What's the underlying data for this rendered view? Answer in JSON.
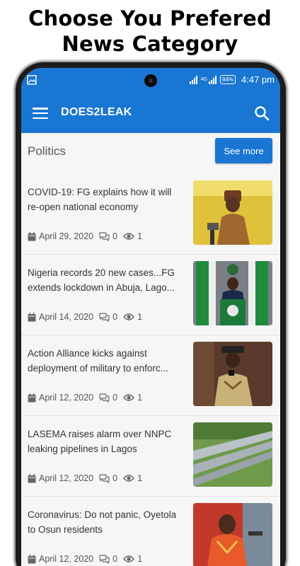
{
  "promo": {
    "line1": "Choose You Prefered",
    "line2": "News Category"
  },
  "statusbar": {
    "net": "4G",
    "battery": "84%",
    "time": "4:47 pm"
  },
  "appbar": {
    "title": "DOES2LEAK"
  },
  "section": {
    "title": "Politics",
    "see_more": "See more"
  },
  "articles": [
    {
      "title": "COVID-19: FG explains how it will re-open national economy",
      "date": "April 29, 2020",
      "comments": "0",
      "views": "1"
    },
    {
      "title": "Nigeria records 20 new cases...FG extends lockdown in Abuja, Lago...",
      "date": "April 14, 2020",
      "comments": "0",
      "views": "1"
    },
    {
      "title": "Action Alliance kicks against deployment of military to enforc...",
      "date": "April 12, 2020",
      "comments": "0",
      "views": "1"
    },
    {
      "title": "LASEMA raises alarm over NNPC leaking pipelines in Lagos",
      "date": "April 12, 2020",
      "comments": "0",
      "views": "1"
    },
    {
      "title": "Coronavirus: Do not panic, Oyetola to Osun residents",
      "date": "April 12, 2020",
      "comments": "0",
      "views": "1"
    }
  ],
  "colors": {
    "primary": "#1976d2",
    "background": "#f6f6f6"
  },
  "icons": [
    "image-icon",
    "signal-icon",
    "battery-icon",
    "menu-icon",
    "search-icon",
    "calendar-icon",
    "comment-icon",
    "eye-icon"
  ]
}
